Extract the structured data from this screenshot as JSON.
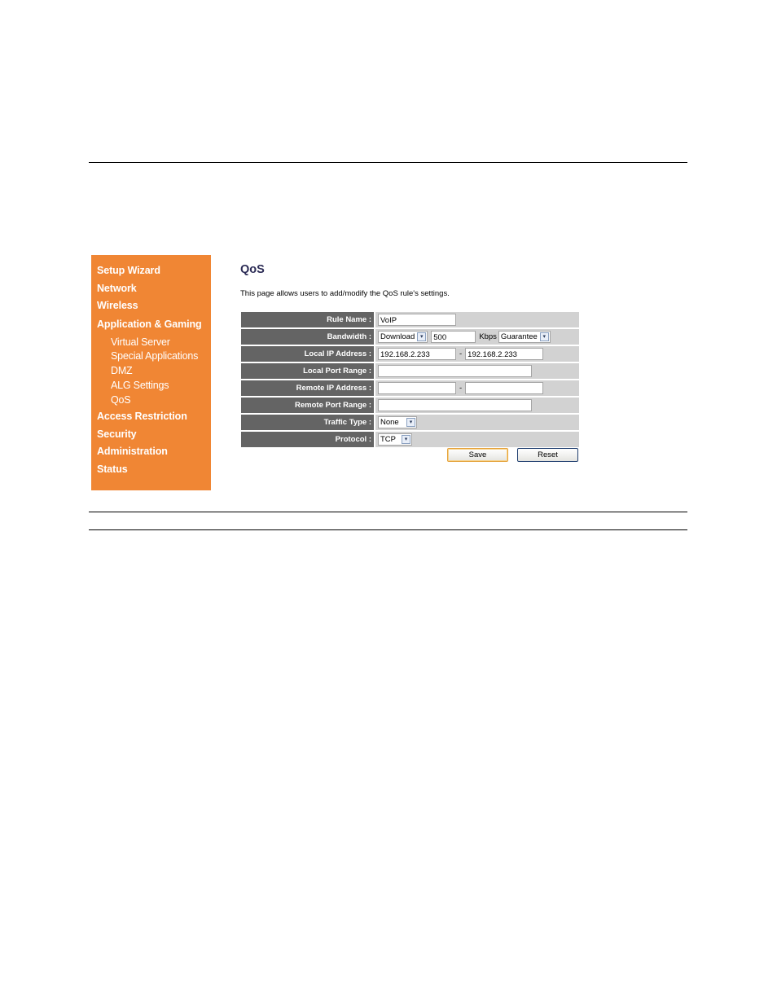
{
  "sidebar": {
    "items": [
      {
        "label": "Setup Wizard"
      },
      {
        "label": "Network"
      },
      {
        "label": "Wireless"
      },
      {
        "label": "Application & Gaming",
        "children": [
          {
            "label": "Virtual Server"
          },
          {
            "label": "Special Applications"
          },
          {
            "label": "DMZ"
          },
          {
            "label": "ALG Settings"
          },
          {
            "label": "QoS"
          }
        ]
      },
      {
        "label": "Access Restriction"
      },
      {
        "label": "Security"
      },
      {
        "label": "Administration"
      },
      {
        "label": "Status"
      }
    ]
  },
  "page": {
    "title": "QoS",
    "description": "This page allows users to add/modify the QoS rule's settings."
  },
  "form": {
    "rule_name": {
      "label": "Rule Name :",
      "value": "VoIP"
    },
    "bandwidth": {
      "label": "Bandwidth :",
      "direction": "Download",
      "value": "500",
      "unit": "Kbps",
      "mode": "Guarantee"
    },
    "local_ip": {
      "label": "Local IP Address :",
      "start": "192.168.2.233",
      "separator": "-",
      "end": "192.168.2.233"
    },
    "local_port": {
      "label": "Local Port Range :",
      "value": ""
    },
    "remote_ip": {
      "label": "Remote IP Address :",
      "start": "",
      "separator": "-",
      "end": ""
    },
    "remote_port": {
      "label": "Remote Port Range :",
      "value": ""
    },
    "traffic_type": {
      "label": "Traffic Type :",
      "value": "None"
    },
    "protocol": {
      "label": "Protocol :",
      "value": "TCP"
    }
  },
  "buttons": {
    "save": "Save",
    "reset": "Reset"
  },
  "icons": {
    "dropdown": "▾"
  }
}
